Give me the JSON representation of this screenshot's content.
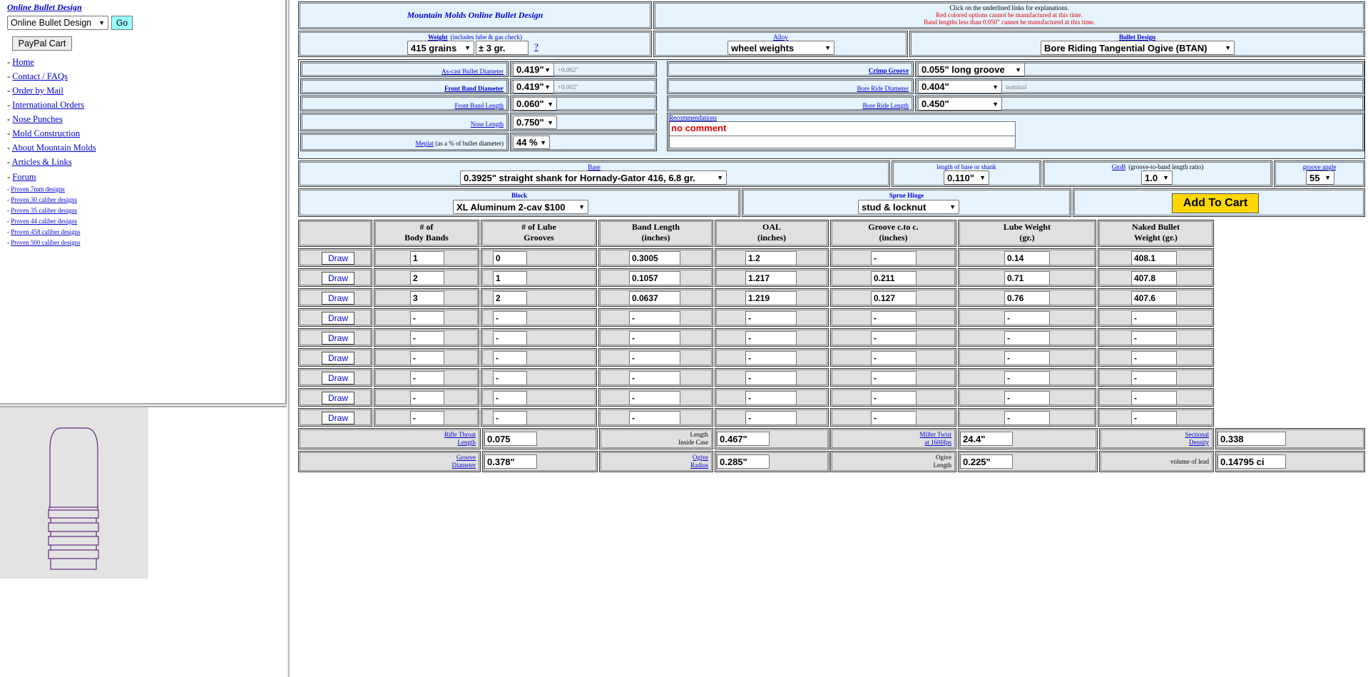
{
  "left": {
    "title": "Online Bullet Design",
    "select_value": "Online Bullet Design",
    "go_label": "Go",
    "paypal_label": "PayPal Cart",
    "nav": [
      "Home",
      "Contact / FAQs",
      "Order by Mail",
      "International Orders",
      "Nose Punches",
      "Mold Construction",
      "About Mountain Molds",
      "Articles & Links",
      "Forum"
    ],
    "proven": [
      "Proven 7mm designs",
      "Proven 30 caliber designs",
      "Proven 35 caliber designs",
      "Proven 44 caliber designs",
      "Proven 458 caliber designs",
      "Proven 500 caliber designs"
    ]
  },
  "header": {
    "title": "Mountain Molds Online Bullet Design",
    "info_line1": "Click on the underlined links for explanations.",
    "info_line2": "Red colored options cannot be manufactured at this time.",
    "info_line3": "Band lengths less than 0.050\" cannot be manufactured at this time."
  },
  "weight": {
    "label": "Weight",
    "note": "(includes lube & gas check)",
    "value": "415 grains",
    "tolerance": "± 3 gr.",
    "help": "?"
  },
  "alloy": {
    "label": "Alloy",
    "value": "wheel weights"
  },
  "design": {
    "label": "Bullet Design",
    "value": "Bore Riding Tangential Ogive (BTAN)"
  },
  "dims": {
    "ascast": {
      "label": "As-cast Bullet Diameter",
      "value": "0.419\"",
      "note": "+0.002\""
    },
    "frontband": {
      "label": "Front Band Diameter",
      "value": "0.419\"",
      "note": "+0.002\""
    },
    "frontbandlen": {
      "label": "Front Band Length",
      "value": "0.060\""
    },
    "noselen": {
      "label": "Nose Length",
      "value": "0.750\""
    },
    "meplat": {
      "label": "Meplat",
      "note": "(as a % of bullet diameter)",
      "value": "44 %"
    },
    "crimp": {
      "label": "Crimp Groove",
      "value": "0.055\" long groove"
    },
    "boreride": {
      "label": "Bore Ride Diameter",
      "value": "0.404\"",
      "note": "nominal"
    },
    "borelen": {
      "label": "Bore Ride Length",
      "value": "0.450\""
    },
    "reco": {
      "label": "Recommendations",
      "value": "no comment",
      "value2": ""
    }
  },
  "base": {
    "label": "Base",
    "value": "0.3925\" straight shank for Hornady-Gator 416, 6.8 gr.",
    "shank_label": "length of base or shank",
    "shank_value": "0.110\"",
    "gtob_label": "GtoB",
    "gtob_note": "(groove-to-band length ratio)",
    "gtob_value": "1.0",
    "angle_label": "groove angle",
    "angle_value": "55"
  },
  "block": {
    "label": "Block",
    "value": "XL Aluminum 2-cav $100",
    "sprue_label": "Sprue Hinge",
    "sprue_value": "stud & locknut",
    "cart_label": "Add To Cart"
  },
  "table": {
    "headers": [
      [
        "# of",
        "Body Bands"
      ],
      [
        "# of Lube",
        "Grooves"
      ],
      [
        "Band Length",
        "(inches)"
      ],
      [
        "OAL",
        "(inches)"
      ],
      [
        "Groove c.to c.",
        "(inches)"
      ],
      [
        "Lube Weight",
        "(gr.)"
      ],
      [
        "Naked Bullet",
        "Weight (gr.)"
      ]
    ],
    "draw_label": "Draw",
    "rows": [
      [
        "1",
        "0",
        "0.3005",
        "1.2",
        "-",
        "0.14",
        "408.1"
      ],
      [
        "2",
        "1",
        "0.1057",
        "1.217",
        "0.211",
        "0.71",
        "407.8"
      ],
      [
        "3",
        "2",
        "0.0637",
        "1.219",
        "0.127",
        "0.76",
        "407.6"
      ],
      [
        "-",
        "-",
        "-",
        "-",
        "-",
        "-",
        "-"
      ],
      [
        "-",
        "-",
        "-",
        "-",
        "-",
        "-",
        "-"
      ],
      [
        "-",
        "-",
        "-",
        "-",
        "-",
        "-",
        "-"
      ],
      [
        "-",
        "-",
        "-",
        "-",
        "-",
        "-",
        "-"
      ],
      [
        "-",
        "-",
        "-",
        "-",
        "-",
        "-",
        "-"
      ],
      [
        "-",
        "-",
        "-",
        "-",
        "-",
        "-",
        "-"
      ]
    ]
  },
  "bottom": {
    "throat": {
      "label1": "Rifle Throat",
      "label2": "Length",
      "value": "0.075"
    },
    "inside": {
      "label1": "Length",
      "label2": "Inside Case",
      "value": "0.467\""
    },
    "twist": {
      "label1": "Miller Twist",
      "label2": "at 1600fps",
      "value": "24.4\""
    },
    "sd": {
      "label1": "Sectional",
      "label2": "Density",
      "value": "0.338"
    },
    "groove": {
      "label1": "Groove",
      "label2": "Diameter",
      "value": "0.378\""
    },
    "ogiver": {
      "label1": "Ogive",
      "label2": "Radius",
      "value": "0.285\""
    },
    "ogivel": {
      "label1": "Ogive",
      "label2": "Length",
      "value": "0.225\""
    },
    "vol": {
      "label1": "volume of lead",
      "value": "0.14795 ci"
    }
  }
}
